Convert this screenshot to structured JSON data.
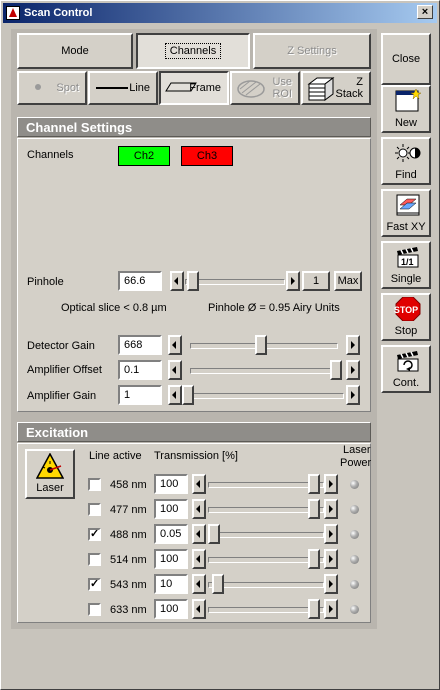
{
  "window": {
    "title": "Scan Control"
  },
  "tabs": {
    "mode": "Mode",
    "channels": "Channels",
    "z_settings": "Z Settings"
  },
  "scan_modes": {
    "spot": "Spot",
    "line": "Line",
    "frame": "Frame",
    "use_roi_1": "Use",
    "use_roi_2": "ROI",
    "z_stack_1": "Z",
    "z_stack_2": "Stack"
  },
  "side_buttons": {
    "close": "Close",
    "new": "New",
    "find": "Find",
    "fast_xy": "Fast XY",
    "single": "Single",
    "stop": "Stop",
    "stop_sign": "STOP",
    "cont": "Cont.",
    "single_badge": "1/1"
  },
  "channel_settings": {
    "header": "Channel Settings",
    "channels_label": "Channels",
    "ch2": "Ch2",
    "ch3": "Ch3",
    "ch2_color": "#00ff00",
    "ch3_color": "#ff0000",
    "pinhole_label": "Pinhole",
    "pinhole_value": "66.6",
    "pinhole_step": "1",
    "pinhole_max": "Max",
    "optical_slice": "Optical slice < 0.8 µm",
    "pinhole_airy": "Pinhole Ø = 0.95 Airy Units",
    "detector_gain_label": "Detector Gain",
    "detector_gain_value": "668",
    "amplifier_offset_label": "Amplifier Offset",
    "amplifier_offset_value": "0.1",
    "amplifier_gain_label": "Amplifier Gain",
    "amplifier_gain_value": "1"
  },
  "excitation": {
    "header": "Excitation",
    "laser_button": "Laser",
    "col_line_active": "Line active",
    "col_transmission": "Transmission [%]",
    "col_laser_power_1": "Laser",
    "col_laser_power_2": "Power",
    "lines": [
      {
        "wavelength": "458 nm",
        "checked": "",
        "transmission": "100"
      },
      {
        "wavelength": "477 nm",
        "checked": "",
        "transmission": "100"
      },
      {
        "wavelength": "488 nm",
        "checked": "✓",
        "transmission": "0.05"
      },
      {
        "wavelength": "514 nm",
        "checked": "",
        "transmission": "100"
      },
      {
        "wavelength": "543 nm",
        "checked": "✓",
        "transmission": "10"
      },
      {
        "wavelength": "633 nm",
        "checked": "",
        "transmission": "100"
      }
    ]
  }
}
